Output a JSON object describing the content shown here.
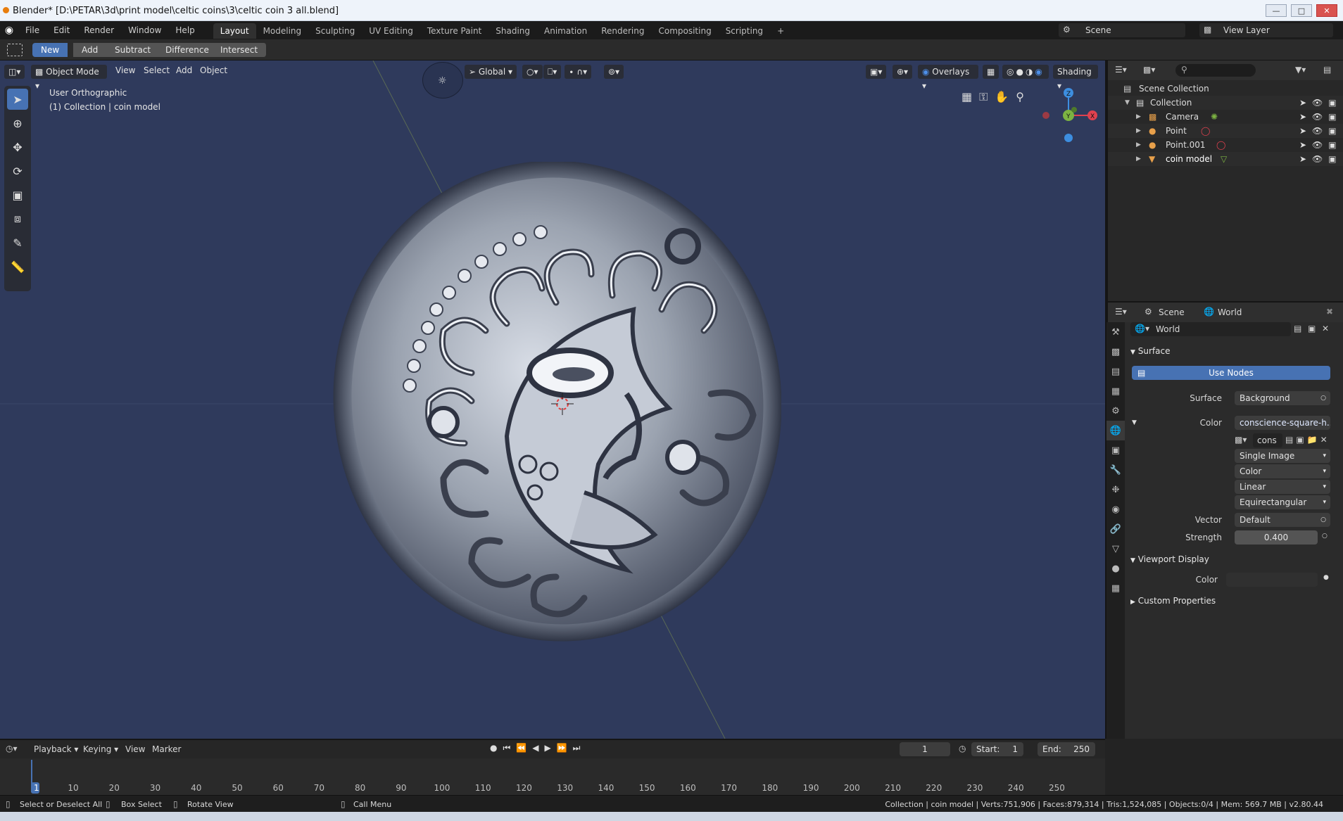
{
  "window": {
    "title": "Blender* [D:\\PETAR\\3d\\print model\\celtic coins\\3\\celtic coin 3 all.blend]"
  },
  "menubar": {
    "menus": [
      "File",
      "Edit",
      "Render",
      "Window",
      "Help"
    ],
    "workspaces": [
      "Layout",
      "Modeling",
      "Sculpting",
      "UV Editing",
      "Texture Paint",
      "Shading",
      "Animation",
      "Rendering",
      "Compositing",
      "Scripting"
    ],
    "active_workspace": "Layout",
    "add_workspace": "+",
    "scene_label": "Scene",
    "view_layer_label": "View Layer"
  },
  "toolheader": {
    "buttons": [
      "New",
      "Add",
      "Subtract",
      "Difference",
      "Intersect"
    ],
    "active": "New"
  },
  "viewport_header": {
    "mode": "Object Mode",
    "menus": [
      "View",
      "Select",
      "Add",
      "Object"
    ],
    "orientation": "Global",
    "overlays": "Overlays",
    "shading": "Shading"
  },
  "viewport_info": {
    "line1": "User Orthographic",
    "line2": "(1) Collection | coin model"
  },
  "gizmo": {
    "x": "X",
    "y": "Y",
    "z": "Z"
  },
  "outliner": {
    "scene_collection": "Scene Collection",
    "collection": "Collection",
    "objects": [
      "Camera",
      "Point",
      "Point.001",
      "coin model"
    ]
  },
  "properties": {
    "breadcrumb_scene": "Scene",
    "breadcrumb_world": "World",
    "world_name": "World",
    "surface_panel": "Surface",
    "use_nodes": "Use Nodes",
    "surface_label": "Surface",
    "surface_value": "Background",
    "color_label": "Color",
    "color_value": "conscience-square-h...",
    "image_name": "cons",
    "image_source": "Single Image",
    "image_colorspace": "Color",
    "interpolation": "Linear",
    "projection": "Equirectangular",
    "vector_label": "Vector",
    "vector_value": "Default",
    "strength_label": "Strength",
    "strength_value": "0.400",
    "viewport_display_panel": "Viewport Display",
    "vd_color_label": "Color",
    "custom_props_panel": "Custom Properties"
  },
  "timeline": {
    "menus": [
      "Playback",
      "Keying",
      "View",
      "Marker"
    ],
    "current_frame": "1",
    "start_label": "Start:",
    "start_value": "1",
    "end_label": "End:",
    "end_value": "250",
    "ticks": [
      "1",
      "10",
      "20",
      "30",
      "40",
      "50",
      "60",
      "70",
      "80",
      "90",
      "100",
      "110",
      "120",
      "130",
      "140",
      "150",
      "160",
      "170",
      "180",
      "190",
      "200",
      "210",
      "220",
      "230",
      "240",
      "250"
    ]
  },
  "statusbar": {
    "hint1": "Select or Deselect All",
    "hint2": "Box Select",
    "hint3": "Rotate View",
    "hint4": "Call Menu",
    "stats": "Collection | coin model | Verts:751,906 | Faces:879,314 | Tris:1,524,085 | Objects:0/4 | Mem: 569.7 MB | v2.80.44"
  },
  "colors": {
    "accent": "#4772b3",
    "viewport_bg": "#2f3a5c",
    "axis_x": "#e0414f",
    "axis_y": "#7cb342",
    "axis_z": "#3d8ee0"
  }
}
